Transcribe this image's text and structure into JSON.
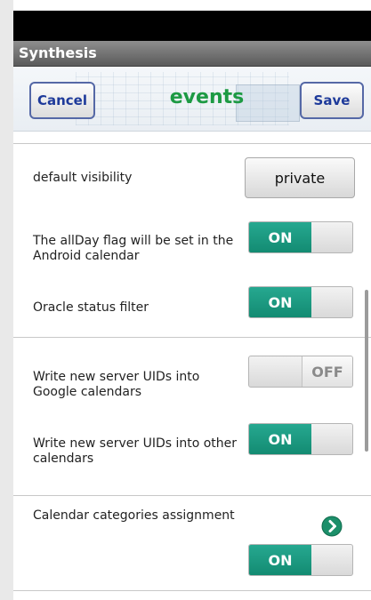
{
  "app": {
    "title": "Synthesis"
  },
  "header": {
    "cancel_label": "Cancel",
    "title": "events",
    "save_label": "Save"
  },
  "settings": {
    "default_visibility": {
      "label": "default visibility",
      "value": "private"
    },
    "all_day_flag": {
      "label_line1": "The allDay flag will be set in the",
      "label_line2": "Android calendar",
      "state": "ON",
      "on": true
    },
    "oracle_status_filter": {
      "label": "Oracle status filter",
      "state": "ON",
      "on": true
    },
    "write_uids_google": {
      "label_line1": "Write new server UIDs into",
      "label_line2": "Google calendars",
      "state": "OFF",
      "on": false
    },
    "write_uids_other": {
      "label_line1": "Write new server UIDs into other",
      "label_line2": "calendars",
      "state": "ON",
      "on": true
    },
    "calendar_categories": {
      "label": "Calendar categories assignment",
      "icon": "chevron-right-circle-icon",
      "state": "ON",
      "on": true
    }
  },
  "colors": {
    "accent_green": "#1d9a43",
    "toggle_on": "#138b72",
    "button_text_blue": "#1e3a9a"
  }
}
